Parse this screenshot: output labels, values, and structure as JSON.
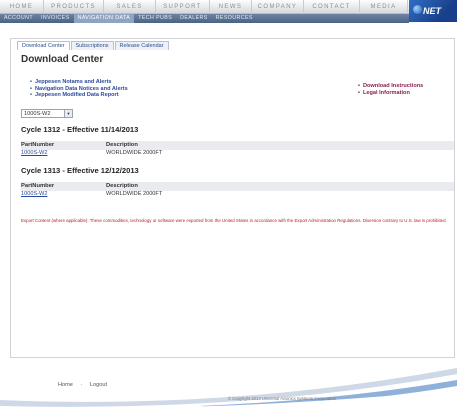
{
  "topnav": {
    "items": [
      "HOME",
      "PRODUCTS",
      "SALES",
      "SUPPORT",
      "NEWS",
      "COMPANY",
      "CONTACT",
      "MEDIA"
    ],
    "logo": "NET"
  },
  "subnav": {
    "items": [
      "ACCOUNT",
      "INVOICES",
      "NAVIGATION DATA",
      "TECH PUBS",
      "DEALERS",
      "RESOURCES"
    ],
    "active": "NAVIGATION DATA"
  },
  "tabs": [
    "Download Center",
    "Subscriptions",
    "Release Calendar"
  ],
  "page_title": "Download Center",
  "links_left": [
    "Jeppesen Notams and Alerts",
    "Navigation Data Notices and Alerts",
    "Jeppesen Modified Data Report"
  ],
  "links_right": [
    "Download Instructions",
    "Legal Information"
  ],
  "select": {
    "value": "1000S-W2"
  },
  "cycles": [
    {
      "title": "Cycle 1312 - Effective 11/14/2013",
      "col_part": "PartNumber",
      "col_desc": "Description",
      "part": "1000S-W2",
      "desc": "WORLDWIDE 2000FT"
    },
    {
      "title": "Cycle 1313 - Effective 12/12/2013",
      "col_part": "PartNumber",
      "col_desc": "Description",
      "part": "1000S-W2",
      "desc": "WORLDWIDE 2000FT"
    }
  ],
  "export_notice": "Export Content (where applicable): These commodities, technology or software were exported from the United States in accordance with the Export Administration Regulations. Diversion contrary to U.S. law is prohibited.",
  "footer": {
    "links": [
      "Home",
      "Logout"
    ],
    "copyright": "© Copyright 2013 Universal Avionics Systems Corporation"
  },
  "colors": {
    "nav_blue": "#4a6384",
    "link": "#2b4a99",
    "secondary_link": "#8a1f4f",
    "warning": "#b2222e"
  }
}
